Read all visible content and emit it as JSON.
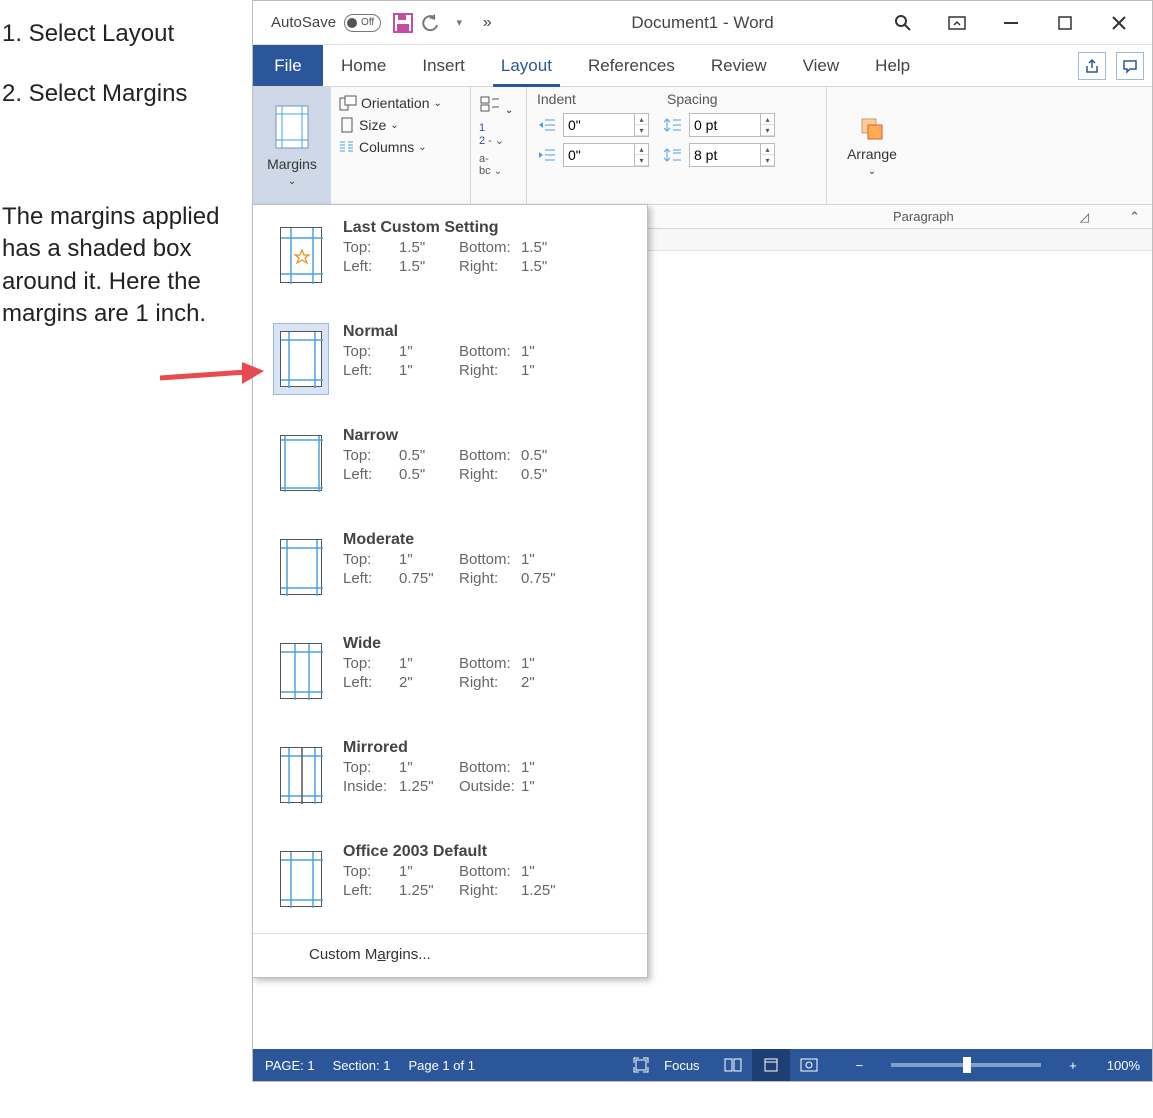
{
  "notes": {
    "step1": "1. Select Layout",
    "step2": "2. Select Margins",
    "explain": "The margins applied has a shaded box around it. Here the margins are 1 inch."
  },
  "titlebar": {
    "autosave_label": "AutoSave",
    "autosave_state": "Off",
    "doc_title": "Document1  -  Word"
  },
  "tabs": {
    "file": "File",
    "home": "Home",
    "insert": "Insert",
    "layout": "Layout",
    "references": "References",
    "review": "Review",
    "view": "View",
    "help": "Help"
  },
  "ribbon": {
    "margins": "Margins",
    "orientation": "Orientation",
    "size": "Size",
    "columns": "Columns",
    "indent_label": "Indent",
    "spacing_label": "Spacing",
    "indent_left": "0\"",
    "indent_right": "0\"",
    "spacing_before": "0 pt",
    "spacing_after": "8 pt",
    "paragraph_label": "Paragraph",
    "arrange": "Arrange"
  },
  "margins_menu": {
    "items": [
      {
        "title": "Last Custom Setting",
        "l1k": "Top:",
        "l1v": "1.5\"",
        "r1k": "Bottom:",
        "r1v": "1.5\"",
        "l2k": "Left:",
        "l2v": "1.5\"",
        "r2k": "Right:",
        "r2v": "1.5\""
      },
      {
        "title": "Normal",
        "l1k": "Top:",
        "l1v": "1\"",
        "r1k": "Bottom:",
        "r1v": "1\"",
        "l2k": "Left:",
        "l2v": "1\"",
        "r2k": "Right:",
        "r2v": "1\"",
        "selected": true
      },
      {
        "title": "Narrow",
        "l1k": "Top:",
        "l1v": "0.5\"",
        "r1k": "Bottom:",
        "r1v": "0.5\"",
        "l2k": "Left:",
        "l2v": "0.5\"",
        "r2k": "Right:",
        "r2v": "0.5\""
      },
      {
        "title": "Moderate",
        "l1k": "Top:",
        "l1v": "1\"",
        "r1k": "Bottom:",
        "r1v": "1\"",
        "l2k": "Left:",
        "l2v": "0.75\"",
        "r2k": "Right:",
        "r2v": "0.75\""
      },
      {
        "title": "Wide",
        "l1k": "Top:",
        "l1v": "1\"",
        "r1k": "Bottom:",
        "r1v": "1\"",
        "l2k": "Left:",
        "l2v": "2\"",
        "r2k": "Right:",
        "r2v": "2\""
      },
      {
        "title": "Mirrored",
        "l1k": "Top:",
        "l1v": "1\"",
        "r1k": "Bottom:",
        "r1v": "1\"",
        "l2k": "Inside:",
        "l2v": "1.25\"",
        "r2k": "Outside:",
        "r2v": "1\""
      },
      {
        "title": "Office 2003 Default",
        "l1k": "Top:",
        "l1v": "1\"",
        "r1k": "Bottom:",
        "r1v": "1\"",
        "l2k": "Left:",
        "l2v": "1.25\"",
        "r2k": "Right:",
        "r2v": "1.25\""
      }
    ],
    "custom": "Custom Margins..."
  },
  "statusbar": {
    "page": "PAGE: 1",
    "section": "Section: 1",
    "pageof": "Page 1 of 1",
    "focus": "Focus",
    "zoom": "100%"
  }
}
